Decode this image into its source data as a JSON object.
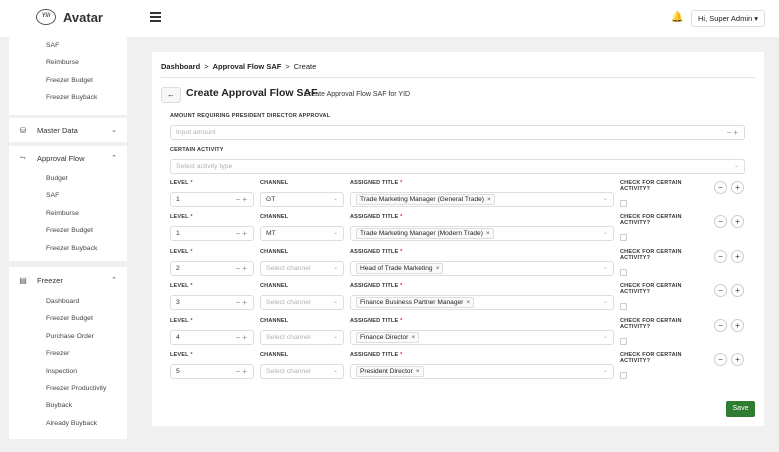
{
  "app": {
    "brand": "Avatar",
    "logo_text": "Yili",
    "user_label": "Hi, Super Admin"
  },
  "sidebar": {
    "top_items": [
      {
        "label": "SAF"
      },
      {
        "label": "Reimburse"
      },
      {
        "label": "Freezer Budget"
      },
      {
        "label": "Freezer Buyback"
      }
    ],
    "master_data": {
      "label": "Master Data"
    },
    "approval_flow": {
      "label": "Approval Flow",
      "items": [
        {
          "label": "Budget"
        },
        {
          "label": "SAF"
        },
        {
          "label": "Reimburse"
        },
        {
          "label": "Freezer Budget"
        },
        {
          "label": "Freezer Buyback"
        }
      ]
    },
    "freezer": {
      "label": "Freezer",
      "items": [
        {
          "label": "Dashboard"
        },
        {
          "label": "Freezer Budget"
        },
        {
          "label": "Purchase Order"
        },
        {
          "label": "Freezer"
        },
        {
          "label": "Inspection"
        },
        {
          "label": "Freezer Productivity"
        },
        {
          "label": "Buyback"
        },
        {
          "label": "Already Buyback"
        }
      ]
    }
  },
  "breadcrumb": {
    "item1": "Dashboard",
    "item2": "Approval Flow SAF",
    "item3": "Create",
    "sep": ">"
  },
  "page": {
    "title": "Create Approval Flow SAF",
    "subtitle": "Create Approval Flow SAF for YID"
  },
  "form": {
    "amount_label": "AMOUNT REQUIRING PRESIDENT DIRECTOR APPROVAL",
    "amount_placeholder": "Input amount",
    "activity_label": "CERTAIN ACTIVITY",
    "activity_placeholder": "Select activity type",
    "level_label": "LEVEL",
    "channel_label": "CHANNEL",
    "title_label": "ASSIGNED TITLE",
    "check_label_1": "CHECK FOR CERTAIN",
    "check_label_2": "ACTIVITY?",
    "required_mark": "*",
    "channel_placeholder": "Select channel",
    "rows": [
      {
        "level": "1",
        "channel": "GT",
        "title": "Trade Marketing Manager (General Trade)"
      },
      {
        "level": "1",
        "channel": "MT",
        "title": "Trade Marketing Manager (Modern Trade)"
      },
      {
        "level": "2",
        "channel": "",
        "title": "Head of Trade Marketing"
      },
      {
        "level": "3",
        "channel": "",
        "title": "Finance Business Partner Manager"
      },
      {
        "level": "4",
        "channel": "",
        "title": "Finance Director"
      },
      {
        "level": "5",
        "channel": "",
        "title": "President Director"
      }
    ],
    "save_label": "Save"
  }
}
